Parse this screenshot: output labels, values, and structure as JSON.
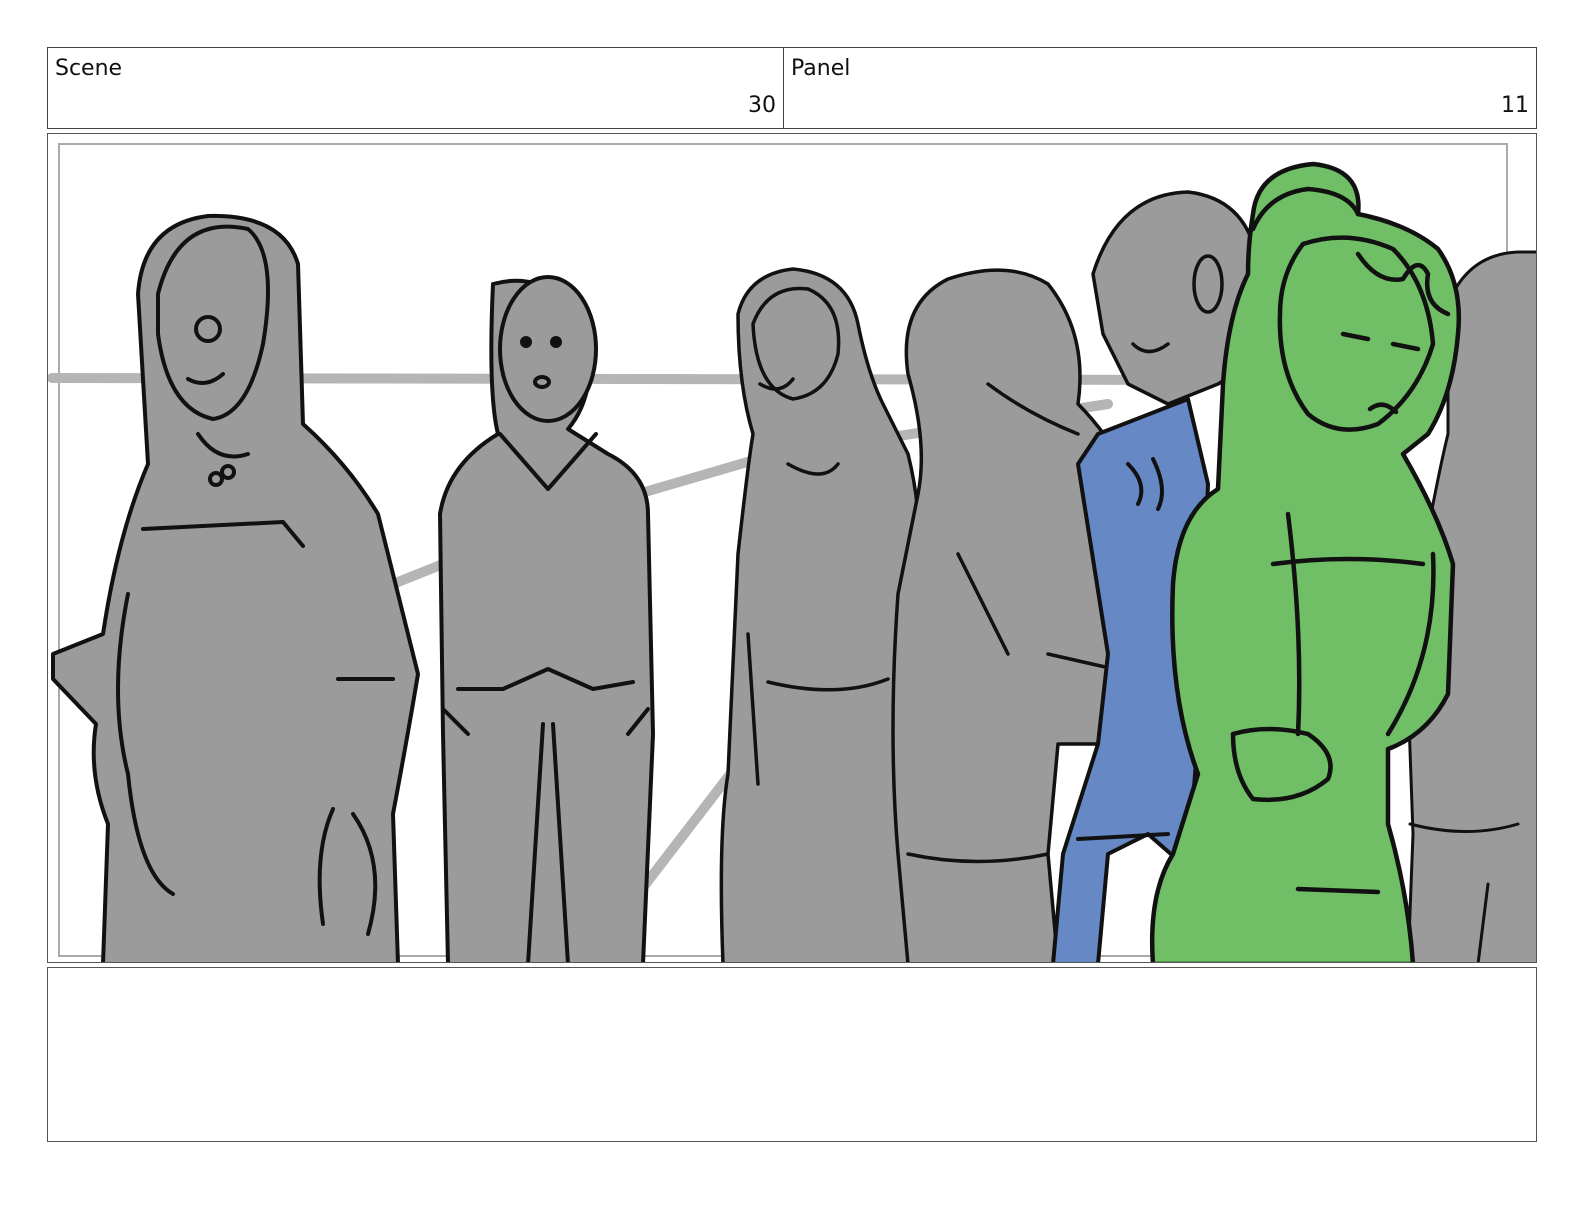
{
  "header": {
    "scene_label": "Scene",
    "scene_number": "30",
    "panel_label": "Panel",
    "panel_number": "11"
  },
  "artwork": {
    "fill_colors": {
      "figures": "#9b9b9b",
      "highlight_green": "#70be65",
      "highlight_blue": "#6688c4",
      "background_lines": "#b5b5b5",
      "outline": "#111111"
    }
  },
  "notes": {
    "text": ""
  }
}
